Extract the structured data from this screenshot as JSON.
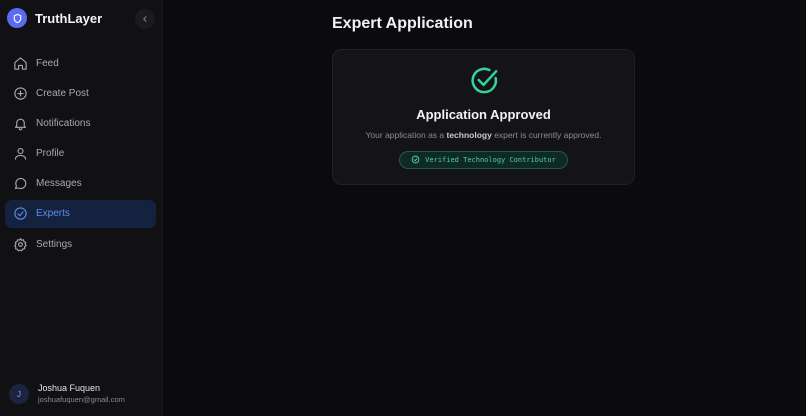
{
  "brand": {
    "name": "TruthLayer"
  },
  "sidebar": {
    "items": [
      {
        "label": "Feed",
        "icon": "home-icon"
      },
      {
        "label": "Create Post",
        "icon": "plus-circle-icon"
      },
      {
        "label": "Notifications",
        "icon": "bell-icon"
      },
      {
        "label": "Profile",
        "icon": "user-icon"
      },
      {
        "label": "Messages",
        "icon": "chat-icon"
      },
      {
        "label": "Experts",
        "icon": "check-circle-icon",
        "active": true
      },
      {
        "label": "Settings",
        "icon": "gear-icon"
      }
    ]
  },
  "user": {
    "initial": "J",
    "name": "Joshua Fuquen",
    "email": "joshuafuquen@gmail.com"
  },
  "main": {
    "title": "Expert Application",
    "card": {
      "title": "Application Approved",
      "desc_prefix": "Your application as a ",
      "desc_field": "technology",
      "desc_suffix": " expert is currently approved.",
      "badge": "Verified Technology Contributor"
    }
  },
  "colors": {
    "accent": "#5b8dee",
    "success": "#34d399",
    "brand": "#5b6cf0"
  }
}
